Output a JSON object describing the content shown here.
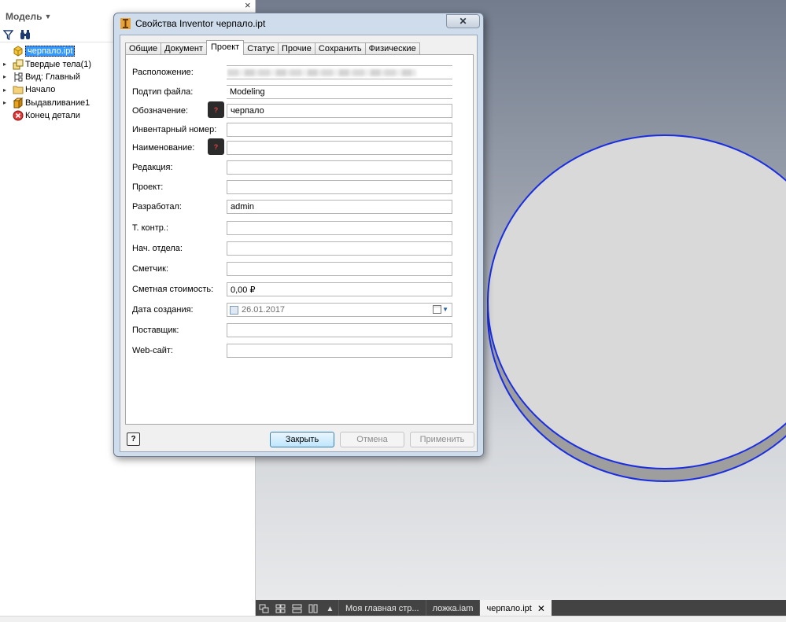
{
  "browser": {
    "title": "Модель",
    "close": "×",
    "tree": [
      {
        "label": "черпало.ipt",
        "icon": "part-icon",
        "selected": true,
        "expander": ""
      },
      {
        "label": "Твердые тела(1)",
        "icon": "solid-bodies-icon",
        "expander": "▸"
      },
      {
        "label": "Вид: Главный",
        "icon": "view-rep-icon",
        "expander": "▸"
      },
      {
        "label": "Начало",
        "icon": "folder-icon",
        "expander": "▸"
      },
      {
        "label": "Выдавливание1",
        "icon": "extrude-icon",
        "expander": "▸"
      },
      {
        "label": "Конец детали",
        "icon": "end-of-part-icon",
        "expander": ""
      }
    ]
  },
  "dialog": {
    "title": "Свойства Inventor черпало.ipt",
    "close": "✕",
    "tabs": [
      "Общие",
      "Документ",
      "Проект",
      "Статус",
      "Прочие",
      "Сохранить",
      "Физические"
    ],
    "active_tab": "Проект",
    "fields": {
      "location": {
        "label": "Расположение:",
        "value": ""
      },
      "subtype": {
        "label": "Подтип файла:",
        "value": "Modeling"
      },
      "part_number": {
        "label": "Обозначение:",
        "value": "черпало",
        "badge": "?"
      },
      "stock_number": {
        "label": "Инвентарный номер:",
        "value": ""
      },
      "description": {
        "label": "Наименование:",
        "value": "",
        "badge": "?"
      },
      "revision": {
        "label": "Редакция:",
        "value": ""
      },
      "project": {
        "label": "Проект:",
        "value": ""
      },
      "designer": {
        "label": "Разработал:",
        "value": "admin"
      },
      "engineer": {
        "label": "Т. контр.:",
        "value": ""
      },
      "authority": {
        "label": "Нач. отдела:",
        "value": ""
      },
      "cost_center": {
        "label": "Сметчик:",
        "value": ""
      },
      "estimated_cost": {
        "label": "Сметная стоимость:",
        "value": "0,00 ₽"
      },
      "creation_date": {
        "label": "Дата создания:",
        "value": "26.01.2017"
      },
      "vendor": {
        "label": "Поставщик:",
        "value": ""
      },
      "website": {
        "label": "Web-сайт:",
        "value": ""
      }
    },
    "help": "?",
    "buttons": {
      "close": "Закрыть",
      "cancel": "Отмена",
      "apply": "Применить"
    }
  },
  "doc_tabs": [
    {
      "label": "Моя главная стр...",
      "active": false,
      "close": ""
    },
    {
      "label": "ложка.iam",
      "active": false,
      "close": ""
    },
    {
      "label": "черпало.ipt",
      "active": true,
      "close": "✕"
    }
  ],
  "colors": {
    "selection": "#3399ff",
    "dialog_frame": "#cfdcec",
    "part_fill": "#d9d9d9",
    "part_edge": "#1a2ee0",
    "doc_bar": "#434343"
  }
}
